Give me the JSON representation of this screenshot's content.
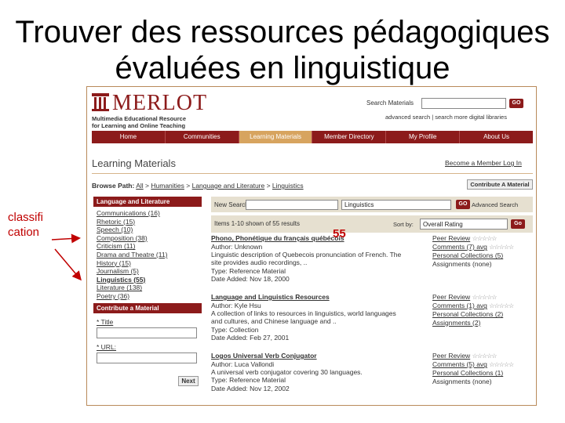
{
  "slide": {
    "title_line1": "Trouver des ressources pédagogiques",
    "title_line2": "évaluées en linguistique",
    "annotation_classification": "classifi cation",
    "annotation_count": "55",
    "accent_color": "#c00000"
  },
  "merlot": {
    "logo_text": "MERLOT",
    "logo_sub1": "Multimedia Educational Resource",
    "logo_sub2": "for Learning and Online Teaching",
    "brand_color": "#8c1b1b",
    "nav_active_color": "#d7a45f",
    "search_label": "Search Materials",
    "go_label": "GO",
    "search_links": "advanced search | search more digital libraries",
    "nav": [
      "Home",
      "Communities",
      "Learning Materials",
      "Member Directory",
      "My Profile",
      "About Us"
    ],
    "nav_active": "Learning Materials",
    "page_heading": "Learning Materials",
    "top_links": "Become a Member   Log In",
    "breadcrumb_prefix": "Browse Path:",
    "breadcrumb": [
      "All",
      "Humanities",
      "Language and Literature",
      "Linguistics"
    ],
    "contribute_button": "Contribute A Material",
    "category_header": "Language and Literature",
    "categories": [
      "Communications (16)",
      "Rhetoric (15)",
      "Speech (10)",
      "Composition (38)",
      "Criticism (11)",
      "Drama and Theatre (11)",
      "History (15)",
      "Journalism (5)",
      "Linguistics (55)",
      "Literature (138)",
      "Poetry (36)"
    ],
    "categories_bold": "Linguistics (55)",
    "contribute_header": "Contribute a Material",
    "title_label": "* Title",
    "url_label": "* URL:",
    "next_label": "Next",
    "new_search_label": "New Search:",
    "new_search_select": "Linguistics",
    "advanced_search": "Advanced Search",
    "results_count": "Items 1-10 shown of 55 results",
    "sort_label": "Sort by:",
    "sort_value": "Overall Rating",
    "go_sort": "Go",
    "results": [
      {
        "title": "Phono, Phonétique du français québécois",
        "lines": [
          "Author: Unknown",
          "Linguistic description of Quebecois pronunciation of French. The",
          "site provides audio recordings, ..",
          "Type: Reference Material",
          "Date Added: Nov 18, 2000"
        ],
        "side": [
          "Peer Review",
          "Comments (7) avg",
          "Personal Collections (5)",
          "Assignments (none)"
        ]
      },
      {
        "title": "Language and Linguistics Resources",
        "lines": [
          "Author: Kyle Hsu",
          "A collection of links to resources in linguistics, world languages",
          "and cultures, and Chinese language and ..",
          "Type: Collection",
          "Date Added: Feb 27, 2001"
        ],
        "side": [
          "Peer Review",
          "Comments (1) avg",
          "Personal Collections (2)",
          "Assignments (2)"
        ]
      },
      {
        "title": "Logos Universal Verb Conjugator",
        "lines": [
          "Author: Luca Vallondi",
          "A universal verb conjugator covering 30 languages.",
          "Type: Reference Material",
          "Date Added: Nov 12, 2002"
        ],
        "side": [
          "Peer Review",
          "Comments (5) avg",
          "Personal Collections (1)",
          "Assignments (none)"
        ]
      }
    ],
    "stars": "☆☆☆☆☆"
  }
}
